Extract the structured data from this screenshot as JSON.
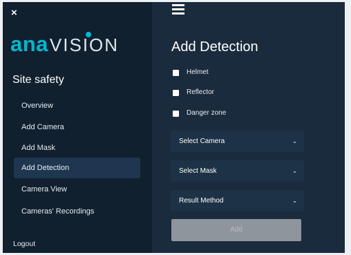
{
  "sidebar": {
    "close_symbol": "×",
    "logo": {
      "part1": "ana",
      "part2": "VISION"
    },
    "section_title": "Site safety",
    "items": [
      {
        "label": "Overview",
        "active": false
      },
      {
        "label": "Add Camera",
        "active": false
      },
      {
        "label": "Add Mask",
        "active": false
      },
      {
        "label": "Add Detection",
        "active": true
      },
      {
        "label": "Camera View",
        "active": false
      },
      {
        "label": "Cameras' Recordings",
        "active": false
      }
    ],
    "logout_label": "Logout"
  },
  "main": {
    "menu_icon": "hamburger-icon",
    "title": "Add Detection",
    "checkboxes": [
      {
        "label": "Helmet",
        "checked": false
      },
      {
        "label": "Reflector",
        "checked": false
      },
      {
        "label": "Danger zone",
        "checked": false
      }
    ],
    "selects": [
      {
        "value": "Select Camera"
      },
      {
        "value": "Select Mask"
      },
      {
        "value": "Result Method"
      }
    ],
    "chevron_symbol": "⌄",
    "add_label": "Add"
  },
  "colors": {
    "accent": "#00b8cf",
    "sidebar_bg": "#11202f",
    "main_bg": "#1a2b3d",
    "active_item_bg": "#1f3650",
    "disabled_button_bg": "#8e959c"
  }
}
